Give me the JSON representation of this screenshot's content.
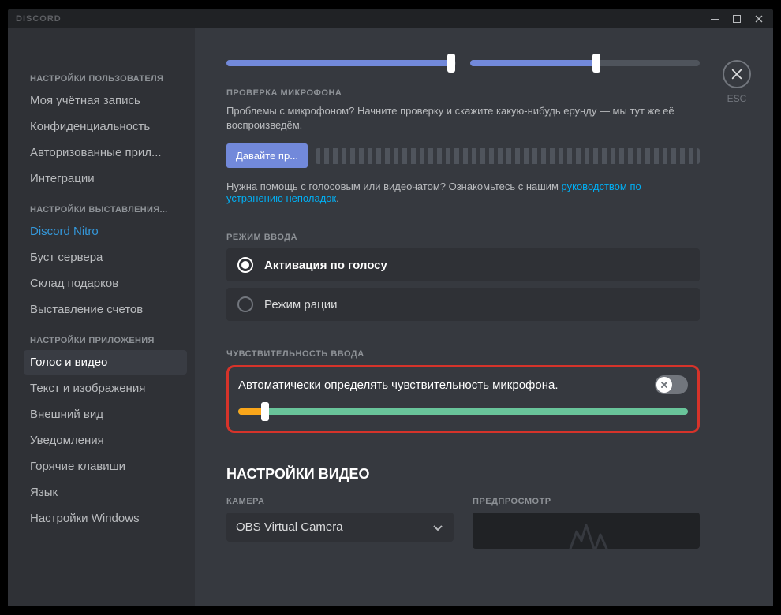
{
  "titlebar": {
    "brand": "DISCORD"
  },
  "close": {
    "label": "ESC"
  },
  "sidebar": {
    "headers": {
      "user": "НАСТРОЙКИ ПОЛЬЗОВАТЕЛЯ",
      "billing": "НАСТРОЙКИ ВЫСТАВЛЕНИЯ...",
      "app": "НАСТРОЙКИ ПРИЛОЖЕНИЯ"
    },
    "items": {
      "account": "Моя учётная запись",
      "privacy": "Конфиденциальность",
      "authorized": "Авторизованные прил...",
      "integrations": "Интеграции",
      "nitro": "Discord Nitro",
      "boost": "Буст сервера",
      "gifts": "Склад подарков",
      "billing": "Выставление счетов",
      "voice": "Голос и видео",
      "text": "Текст и изображения",
      "appearance": "Внешний вид",
      "notifications": "Уведомления",
      "keybinds": "Горячие клавиши",
      "language": "Язык",
      "windows": "Настройки Windows"
    }
  },
  "sliders": {
    "left_fill": 98,
    "right_fill": 55
  },
  "mic_check": {
    "header": "ПРОВЕРКА МИКРОФОНА",
    "desc": "Проблемы с микрофоном? Начните проверку и скажите какую-нибудь ерунду — мы тут же её воспроизведём.",
    "button": "Давайте пр...",
    "help_pre": "Нужна помощь с голосовым или видеочатом? Ознакомьтесь с нашим ",
    "help_link": "руководством по устранению неполадок",
    "help_post": "."
  },
  "input_mode": {
    "header": "РЕЖИМ ВВОДА",
    "voice": "Активация по голосу",
    "ptt": "Режим рации"
  },
  "sensitivity": {
    "header": "ЧУВСТВИТЕЛЬНОСТЬ ВВОДА",
    "auto_label": "Автоматически определять чувствительность микрофона.",
    "threshold_pct": 6
  },
  "video": {
    "header": "НАСТРОЙКИ ВИДЕО",
    "camera_label": "КАМЕРА",
    "camera_value": "OBS Virtual Camera",
    "preview_label": "ПРЕДПРОСМОТР"
  }
}
